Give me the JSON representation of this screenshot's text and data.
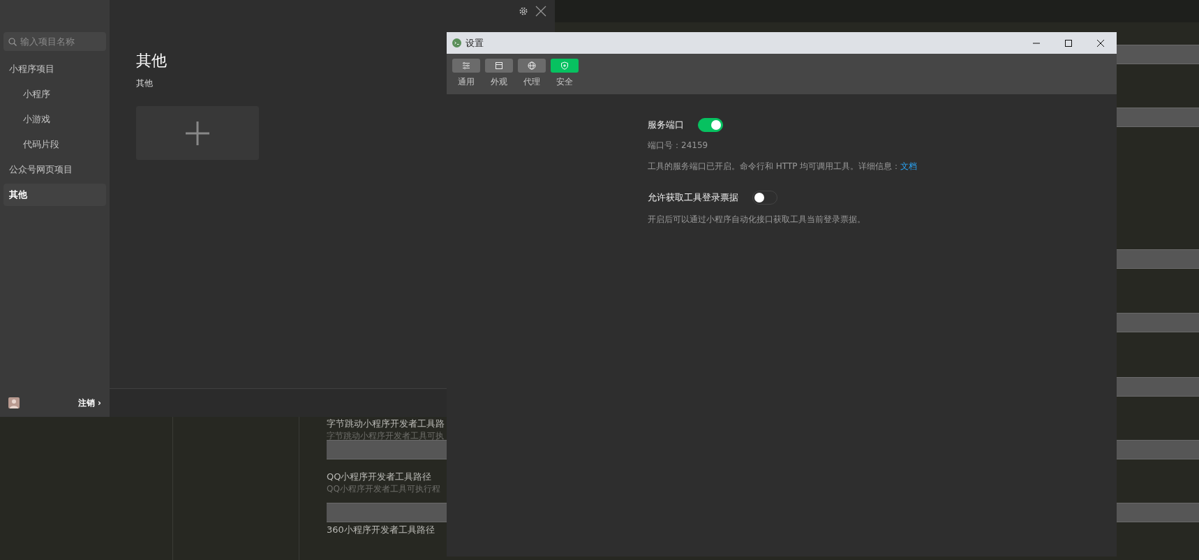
{
  "background": {
    "sections": [
      {
        "label": "字节跳动小程序开发者工具路",
        "hint": "字节跳动小程序开发者工具可执"
      },
      {
        "label": "QQ小程序开发者工具路径",
        "hint": "QQ小程序开发者工具可执行程"
      },
      {
        "label": "360小程序开发者工具路径"
      }
    ]
  },
  "launcher": {
    "search": {
      "placeholder": "输入项目名称"
    },
    "nav": [
      {
        "label": "小程序项目",
        "selected": false,
        "children": [
          {
            "label": "小程序",
            "selected": false
          },
          {
            "label": "小游戏",
            "selected": false
          },
          {
            "label": "代码片段",
            "selected": false
          }
        ]
      },
      {
        "label": "公众号网页项目",
        "selected": false
      },
      {
        "label": "其他",
        "selected": true
      }
    ],
    "heading": "其他",
    "subheading": "其他",
    "logout": "注销",
    "logout_arrow": "›"
  },
  "settings": {
    "title": "设置",
    "tabs": [
      {
        "label": "通用",
        "kind": "sliders",
        "selected": false
      },
      {
        "label": "外观",
        "kind": "window",
        "selected": false
      },
      {
        "label": "代理",
        "kind": "globe",
        "selected": false
      },
      {
        "label": "安全",
        "kind": "shield",
        "selected": true
      }
    ],
    "options": [
      {
        "label": "服务端口",
        "on": true,
        "port": "端口号：24159",
        "description": "工具的服务端口已开启。命令行和 HTTP 均可调用工具。详细信息：",
        "link": "文档"
      },
      {
        "label": "允许获取工具登录票据",
        "on": false,
        "description": "开启后可以通过小程序自动化接口获取工具当前登录票据。"
      }
    ]
  }
}
